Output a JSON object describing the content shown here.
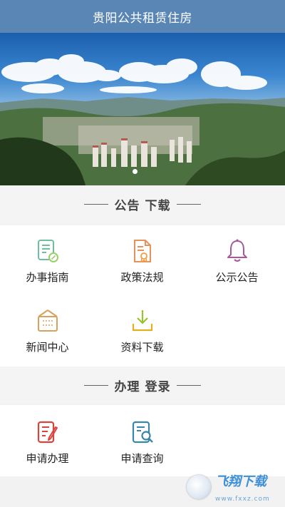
{
  "header": {
    "title": "贵阳公共租赁住房"
  },
  "banner": {
    "carousel_index": 1,
    "carousel_total": 1
  },
  "sections": {
    "announcements": {
      "title": "公告 下载",
      "items": [
        {
          "label": "办事指南",
          "icon": "guide-icon"
        },
        {
          "label": "政策法规",
          "icon": "policy-icon"
        },
        {
          "label": "公示公告",
          "icon": "bell-icon"
        },
        {
          "label": "新闻中心",
          "icon": "news-icon"
        },
        {
          "label": "资料下载",
          "icon": "download-icon"
        }
      ]
    },
    "services": {
      "title": "办理 登录",
      "items": [
        {
          "label": "申请办理",
          "icon": "apply-icon"
        },
        {
          "label": "申请查询",
          "icon": "query-icon"
        }
      ]
    }
  },
  "watermark": {
    "main": "飞翔下载",
    "sub": "www.fxxz.com"
  },
  "colors": {
    "header": "#5a86b6",
    "guide": "#6cc0a0",
    "policy": "#e8925a",
    "bell": "#a55a9a",
    "news": "#d7a25a",
    "download": "#9bbf2e",
    "apply": "#d8453f",
    "query": "#3a86a8"
  }
}
